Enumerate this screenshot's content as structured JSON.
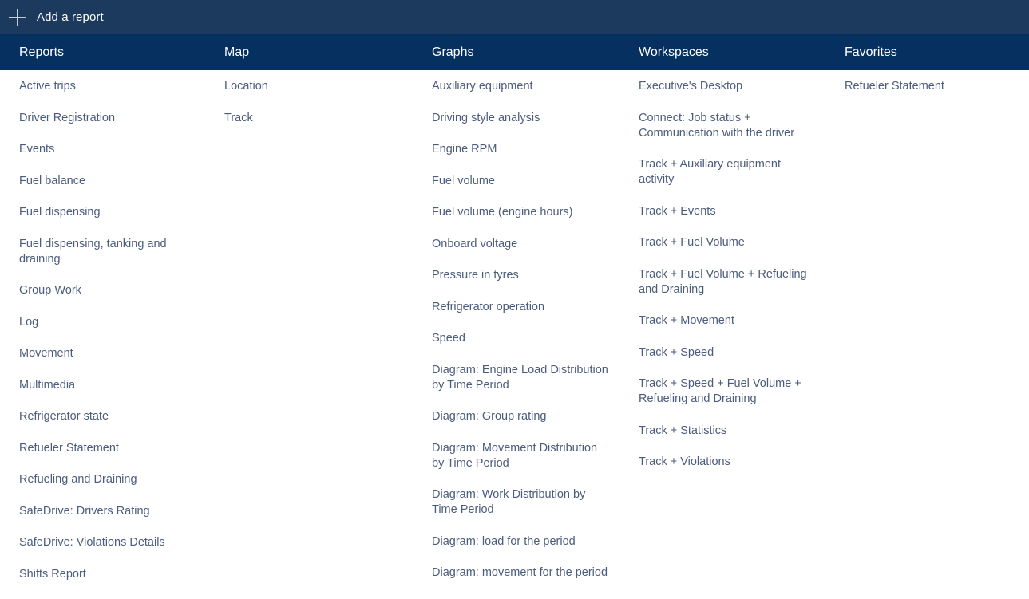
{
  "toolbar": {
    "add_report_label": "Add a report",
    "add_icon": "plus-icon"
  },
  "theme": {
    "topbar_bg": "#1c3a5e",
    "header_bg": "#06305f",
    "page_bg": "#ffffff",
    "header_text": "#ffffff",
    "item_text": "#4c5c7d"
  },
  "columns": [
    {
      "title": "Reports",
      "items": [
        "Active trips",
        "Driver Registration",
        "Events",
        "Fuel balance",
        "Fuel dispensing",
        "Fuel dispensing, tanking and draining",
        "Group Work",
        "Log",
        "Movement",
        "Multimedia",
        "Refrigerator state",
        "Refueler Statement",
        "Refueling and Draining",
        "SafeDrive: Drivers Rating",
        "SafeDrive: Violations Details",
        "Shifts Report"
      ]
    },
    {
      "title": "Map",
      "items": [
        "Location",
        "Track"
      ]
    },
    {
      "title": "Graphs",
      "items": [
        "Auxiliary equipment",
        "Driving style analysis",
        "Engine RPM",
        "Fuel volume",
        "Fuel volume (engine hours)",
        "Onboard voltage",
        "Pressure in tyres",
        "Refrigerator operation",
        "Speed",
        "Diagram: Engine Load Distribution by Time Period",
        "Diagram: Group rating",
        "Diagram: Movement Distribution by Time Period",
        "Diagram: Work Distribution by Time Period",
        "Diagram: load for the period",
        "Diagram: movement for the period"
      ]
    },
    {
      "title": "Workspaces",
      "items": [
        "Executive's Desktop",
        "Connect: Job status + Communication with the driver",
        "Track + Auxiliary equipment activity",
        "Track + Events",
        "Track + Fuel Volume",
        "Track + Fuel Volume + Refueling and Draining",
        "Track + Movement",
        "Track + Speed",
        "Track + Speed + Fuel Volume + Refueling and Draining",
        "Track + Statistics",
        "Track + Violations"
      ]
    },
    {
      "title": "Favorites",
      "items": [
        "Refueler Statement"
      ]
    }
  ]
}
